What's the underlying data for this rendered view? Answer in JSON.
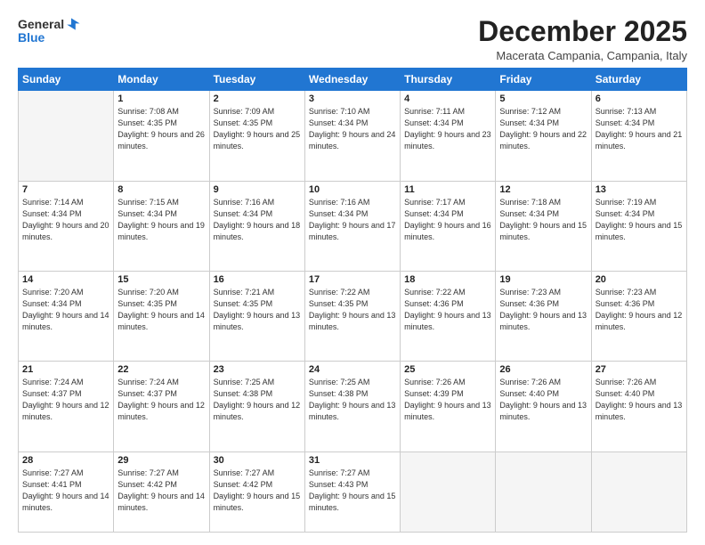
{
  "logo": {
    "general": "General",
    "blue": "Blue"
  },
  "title": "December 2025",
  "location": "Macerata Campania, Campania, Italy",
  "days_header": [
    "Sunday",
    "Monday",
    "Tuesday",
    "Wednesday",
    "Thursday",
    "Friday",
    "Saturday"
  ],
  "weeks": [
    [
      {
        "day": "",
        "empty": true
      },
      {
        "day": "1",
        "sunrise": "7:08 AM",
        "sunset": "4:35 PM",
        "daylight": "9 hours and 26 minutes."
      },
      {
        "day": "2",
        "sunrise": "7:09 AM",
        "sunset": "4:35 PM",
        "daylight": "9 hours and 25 minutes."
      },
      {
        "day": "3",
        "sunrise": "7:10 AM",
        "sunset": "4:34 PM",
        "daylight": "9 hours and 24 minutes."
      },
      {
        "day": "4",
        "sunrise": "7:11 AM",
        "sunset": "4:34 PM",
        "daylight": "9 hours and 23 minutes."
      },
      {
        "day": "5",
        "sunrise": "7:12 AM",
        "sunset": "4:34 PM",
        "daylight": "9 hours and 22 minutes."
      },
      {
        "day": "6",
        "sunrise": "7:13 AM",
        "sunset": "4:34 PM",
        "daylight": "9 hours and 21 minutes."
      }
    ],
    [
      {
        "day": "7",
        "sunrise": "7:14 AM",
        "sunset": "4:34 PM",
        "daylight": "9 hours and 20 minutes."
      },
      {
        "day": "8",
        "sunrise": "7:15 AM",
        "sunset": "4:34 PM",
        "daylight": "9 hours and 19 minutes."
      },
      {
        "day": "9",
        "sunrise": "7:16 AM",
        "sunset": "4:34 PM",
        "daylight": "9 hours and 18 minutes."
      },
      {
        "day": "10",
        "sunrise": "7:16 AM",
        "sunset": "4:34 PM",
        "daylight": "9 hours and 17 minutes."
      },
      {
        "day": "11",
        "sunrise": "7:17 AM",
        "sunset": "4:34 PM",
        "daylight": "9 hours and 16 minutes."
      },
      {
        "day": "12",
        "sunrise": "7:18 AM",
        "sunset": "4:34 PM",
        "daylight": "9 hours and 15 minutes."
      },
      {
        "day": "13",
        "sunrise": "7:19 AM",
        "sunset": "4:34 PM",
        "daylight": "9 hours and 15 minutes."
      }
    ],
    [
      {
        "day": "14",
        "sunrise": "7:20 AM",
        "sunset": "4:34 PM",
        "daylight": "9 hours and 14 minutes."
      },
      {
        "day": "15",
        "sunrise": "7:20 AM",
        "sunset": "4:35 PM",
        "daylight": "9 hours and 14 minutes."
      },
      {
        "day": "16",
        "sunrise": "7:21 AM",
        "sunset": "4:35 PM",
        "daylight": "9 hours and 13 minutes."
      },
      {
        "day": "17",
        "sunrise": "7:22 AM",
        "sunset": "4:35 PM",
        "daylight": "9 hours and 13 minutes."
      },
      {
        "day": "18",
        "sunrise": "7:22 AM",
        "sunset": "4:36 PM",
        "daylight": "9 hours and 13 minutes."
      },
      {
        "day": "19",
        "sunrise": "7:23 AM",
        "sunset": "4:36 PM",
        "daylight": "9 hours and 13 minutes."
      },
      {
        "day": "20",
        "sunrise": "7:23 AM",
        "sunset": "4:36 PM",
        "daylight": "9 hours and 12 minutes."
      }
    ],
    [
      {
        "day": "21",
        "sunrise": "7:24 AM",
        "sunset": "4:37 PM",
        "daylight": "9 hours and 12 minutes."
      },
      {
        "day": "22",
        "sunrise": "7:24 AM",
        "sunset": "4:37 PM",
        "daylight": "9 hours and 12 minutes."
      },
      {
        "day": "23",
        "sunrise": "7:25 AM",
        "sunset": "4:38 PM",
        "daylight": "9 hours and 12 minutes."
      },
      {
        "day": "24",
        "sunrise": "7:25 AM",
        "sunset": "4:38 PM",
        "daylight": "9 hours and 13 minutes."
      },
      {
        "day": "25",
        "sunrise": "7:26 AM",
        "sunset": "4:39 PM",
        "daylight": "9 hours and 13 minutes."
      },
      {
        "day": "26",
        "sunrise": "7:26 AM",
        "sunset": "4:40 PM",
        "daylight": "9 hours and 13 minutes."
      },
      {
        "day": "27",
        "sunrise": "7:26 AM",
        "sunset": "4:40 PM",
        "daylight": "9 hours and 13 minutes."
      }
    ],
    [
      {
        "day": "28",
        "sunrise": "7:27 AM",
        "sunset": "4:41 PM",
        "daylight": "9 hours and 14 minutes."
      },
      {
        "day": "29",
        "sunrise": "7:27 AM",
        "sunset": "4:42 PM",
        "daylight": "9 hours and 14 minutes."
      },
      {
        "day": "30",
        "sunrise": "7:27 AM",
        "sunset": "4:42 PM",
        "daylight": "9 hours and 15 minutes."
      },
      {
        "day": "31",
        "sunrise": "7:27 AM",
        "sunset": "4:43 PM",
        "daylight": "9 hours and 15 minutes."
      },
      {
        "day": "",
        "empty": true
      },
      {
        "day": "",
        "empty": true
      },
      {
        "day": "",
        "empty": true
      }
    ]
  ]
}
